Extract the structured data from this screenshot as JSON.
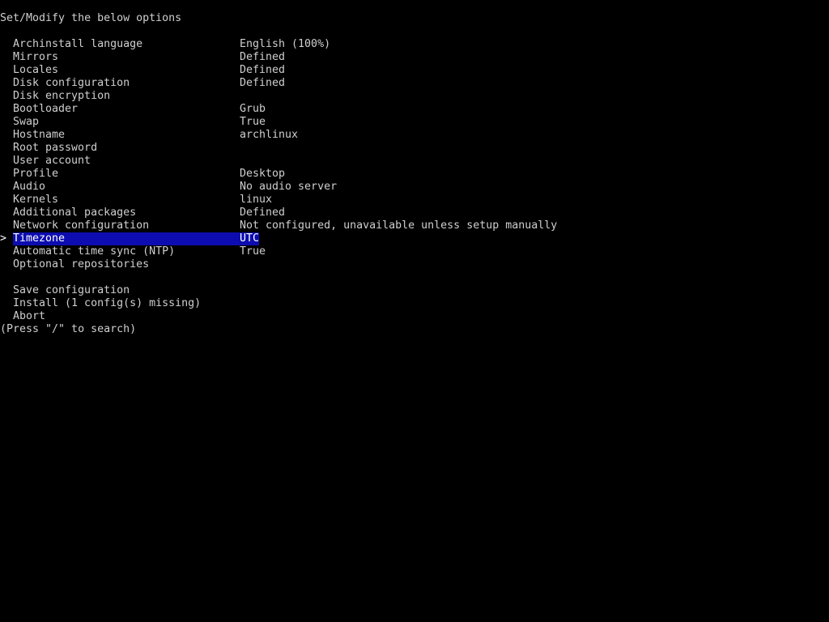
{
  "title": "Set/Modify the below options",
  "cursor_glyph": ">",
  "colors": {
    "background": "#000000",
    "text": "#cfcfcf",
    "selection": "#0c0cb0"
  },
  "menu": [
    {
      "label": "Archinstall language",
      "value": "English (100%)"
    },
    {
      "label": "Mirrors",
      "value": "Defined"
    },
    {
      "label": "Locales",
      "value": "Defined"
    },
    {
      "label": "Disk configuration",
      "value": "Defined"
    },
    {
      "label": "Disk encryption",
      "value": ""
    },
    {
      "label": "Bootloader",
      "value": "Grub"
    },
    {
      "label": "Swap",
      "value": "True"
    },
    {
      "label": "Hostname",
      "value": "archlinux"
    },
    {
      "label": "Root password",
      "value": ""
    },
    {
      "label": "User account",
      "value": ""
    },
    {
      "label": "Profile",
      "value": "Desktop"
    },
    {
      "label": "Audio",
      "value": "No audio server"
    },
    {
      "label": "Kernels",
      "value": "linux"
    },
    {
      "label": "Additional packages",
      "value": "Defined"
    },
    {
      "label": "Network configuration",
      "value": "Not configured, unavailable unless setup manually"
    },
    {
      "label": "Timezone",
      "value": "UTC",
      "selected": true
    },
    {
      "label": "Automatic time sync (NTP)",
      "value": "True"
    },
    {
      "label": "Optional repositories",
      "value": ""
    }
  ],
  "actions": [
    {
      "label": "Save configuration"
    },
    {
      "label": "Install (1 config(s) missing)"
    },
    {
      "label": "Abort"
    }
  ],
  "search_hint": "(Press \"/\" to search)"
}
